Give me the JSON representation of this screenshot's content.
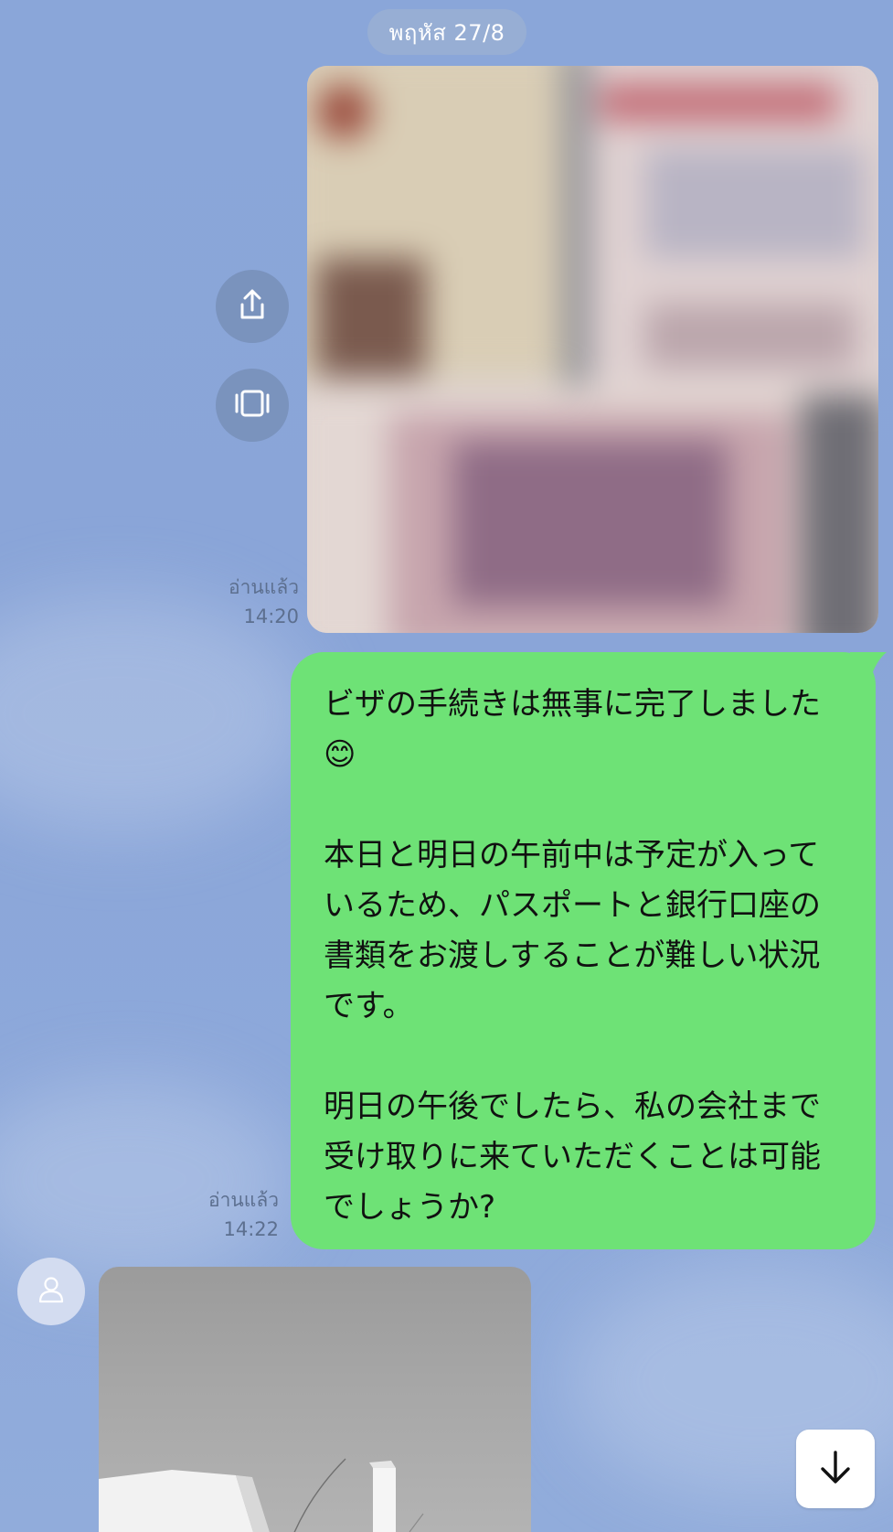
{
  "chat": {
    "date_separator": "พฤหัส 27/8",
    "messages": {
      "sent_photo": {
        "read_status": "อ่านแล้ว",
        "time": "14:20"
      },
      "sent_text": {
        "text": "ビザの手続きは無事に完了しました😊\n\n本日と明日の午前中は予定が入っているため、パスポートと銀行口座の書類をお渡しすることが難しい状況です。\n\n明日の午後でしたら、私の会社まで受け取りに来ていただくことは可能でしょうか?",
        "read_status": "อ่านแล้ว",
        "time": "14:22"
      }
    }
  },
  "icons": {
    "share": "share-icon",
    "gallery": "gallery-icon",
    "avatar": "user-icon",
    "scroll": "arrow-down-icon"
  },
  "colors": {
    "background": "#8aa6d9",
    "sent_bubble": "#6ee276",
    "date_pill": "#97aed4",
    "meta_text": "#5c6f8f"
  }
}
